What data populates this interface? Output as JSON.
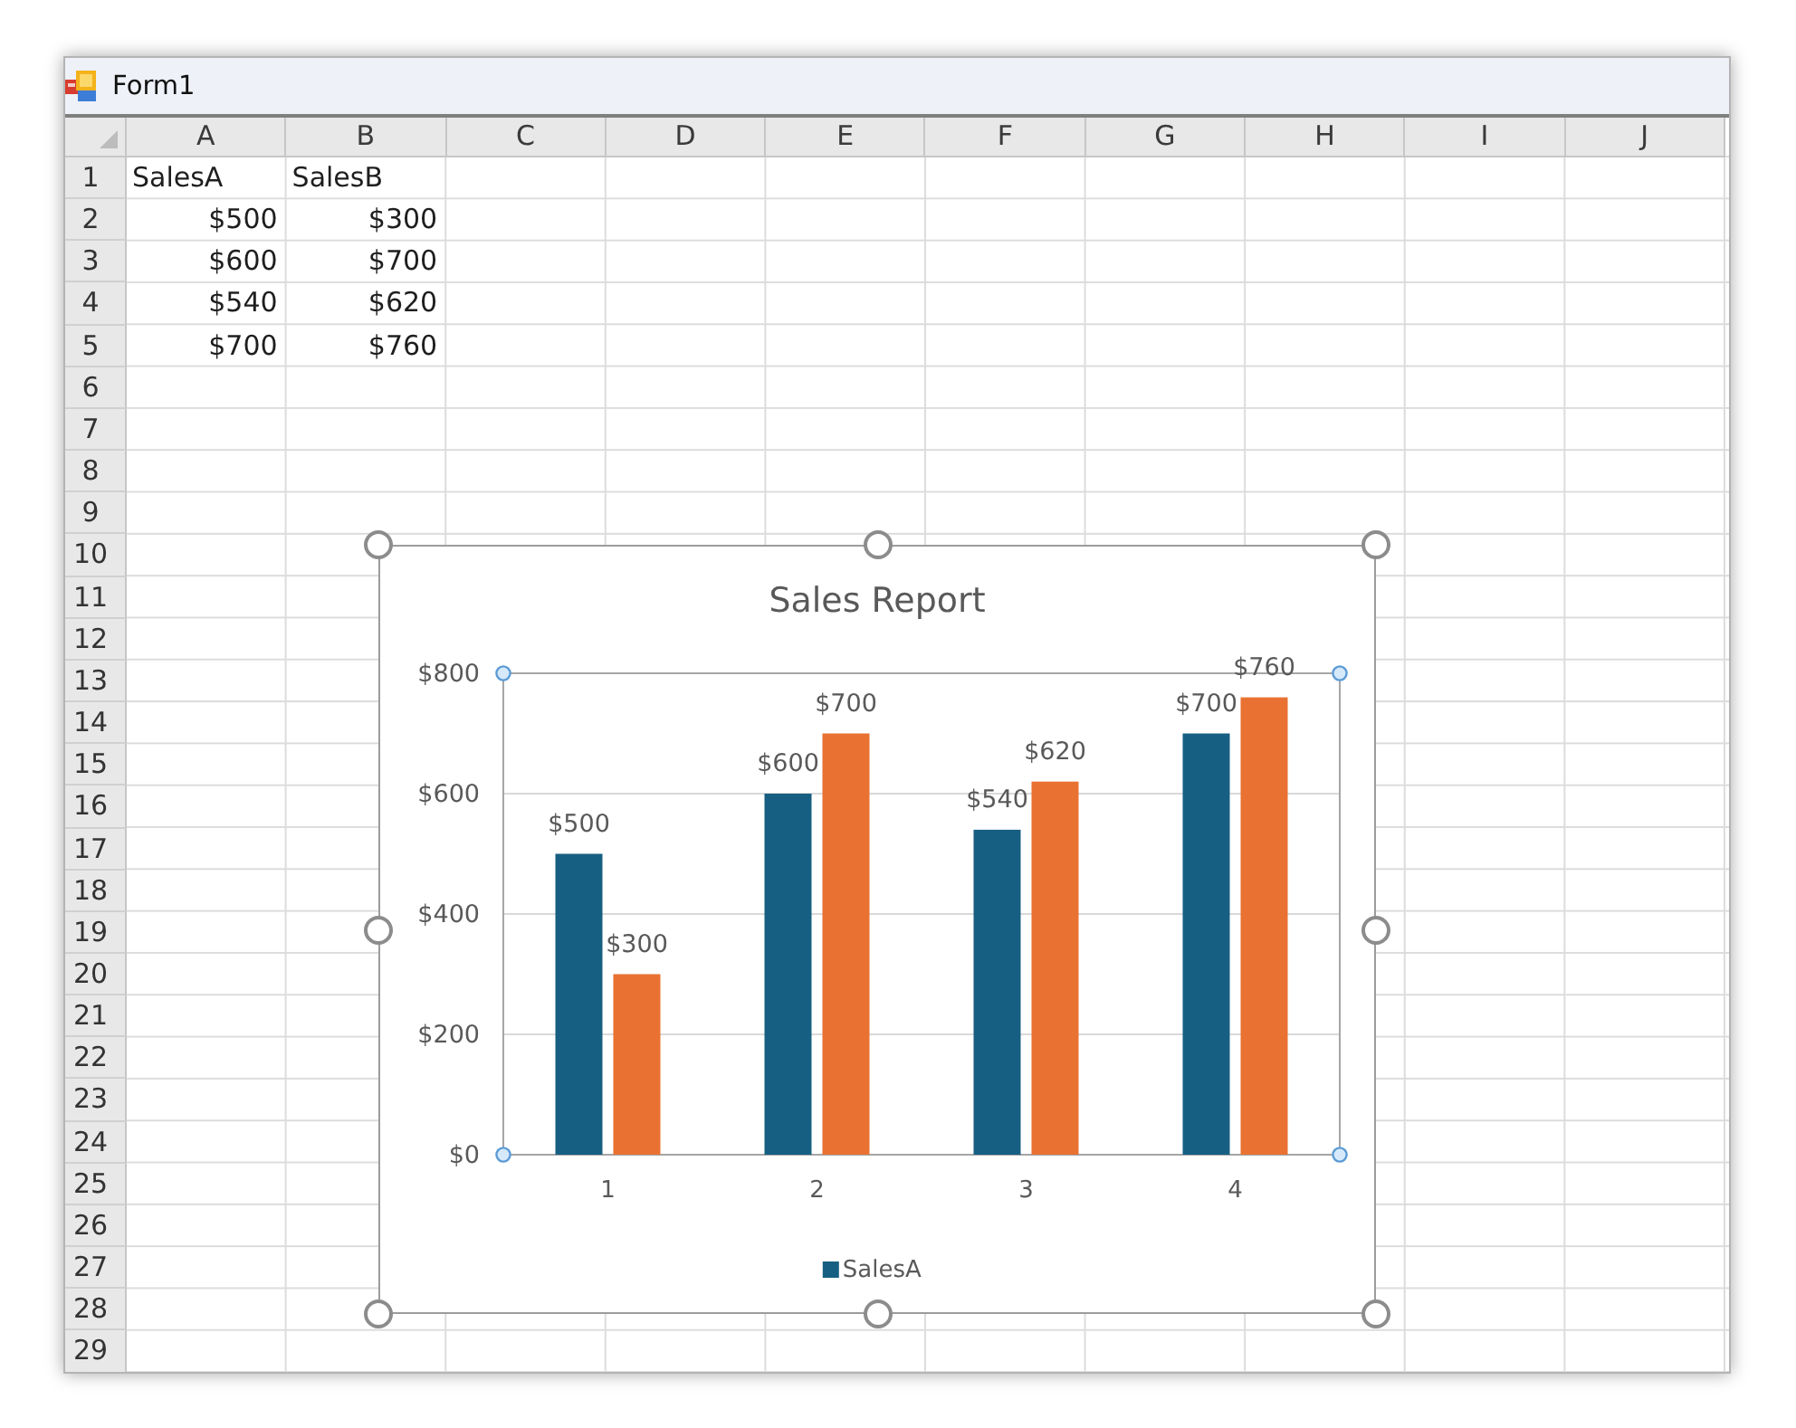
{
  "window": {
    "title": "Form1"
  },
  "sheet": {
    "columns": [
      "A",
      "B",
      "C",
      "D",
      "E",
      "F",
      "G",
      "H",
      "I",
      "J"
    ],
    "rows": [
      {
        "label": "1",
        "cells": [
          {
            "kind": "text",
            "text": "SalesA"
          },
          {
            "kind": "text",
            "text": "SalesB"
          }
        ]
      },
      {
        "label": "2",
        "cells": [
          {
            "kind": "number",
            "text": "$500"
          },
          {
            "kind": "number",
            "text": "$300"
          }
        ]
      },
      {
        "label": "3",
        "cells": [
          {
            "kind": "number",
            "text": "$600"
          },
          {
            "kind": "number",
            "text": "$700"
          }
        ]
      },
      {
        "label": "4",
        "cells": [
          {
            "kind": "number",
            "text": "$540"
          },
          {
            "kind": "number",
            "text": "$620"
          }
        ]
      },
      {
        "label": "5",
        "cells": [
          {
            "kind": "number",
            "text": "$700"
          },
          {
            "kind": "number",
            "text": "$760"
          }
        ]
      },
      {
        "label": "6"
      },
      {
        "label": "7"
      },
      {
        "label": "8"
      },
      {
        "label": "9"
      },
      {
        "label": "10"
      },
      {
        "label": "11"
      },
      {
        "label": "12"
      },
      {
        "label": "13"
      },
      {
        "label": "14"
      },
      {
        "label": "15"
      },
      {
        "label": "16"
      },
      {
        "label": "17"
      },
      {
        "label": "18"
      },
      {
        "label": "19"
      },
      {
        "label": "20"
      },
      {
        "label": "21"
      },
      {
        "label": "22"
      },
      {
        "label": "23"
      },
      {
        "label": "24"
      },
      {
        "label": "25"
      },
      {
        "label": "26"
      },
      {
        "label": "27"
      },
      {
        "label": "28"
      },
      {
        "label": "29"
      }
    ]
  },
  "chart": {
    "selected": true,
    "plot_area_selected": true,
    "chart_data": {
      "type": "bar",
      "title": "Sales Report",
      "categories": [
        "1",
        "2",
        "3",
        "4"
      ],
      "series": [
        {
          "name": "SalesA",
          "color": "#175f82",
          "values": [
            500,
            600,
            540,
            700
          ]
        },
        {
          "color": "#e97132",
          "values": [
            300,
            700,
            620,
            760
          ]
        }
      ],
      "ylim": [
        0,
        800
      ],
      "yticks": [
        {
          "value": 0,
          "label": "$0"
        },
        {
          "value": 200,
          "label": "$200"
        },
        {
          "value": 400,
          "label": "$400"
        },
        {
          "value": 600,
          "label": "$600"
        },
        {
          "value": 800,
          "label": "$800"
        }
      ],
      "grid": true,
      "value_labels": [
        [
          "$500",
          "$600",
          "$540",
          "$700"
        ],
        [
          "$300",
          "$700",
          "$620",
          "$760"
        ]
      ]
    }
  }
}
